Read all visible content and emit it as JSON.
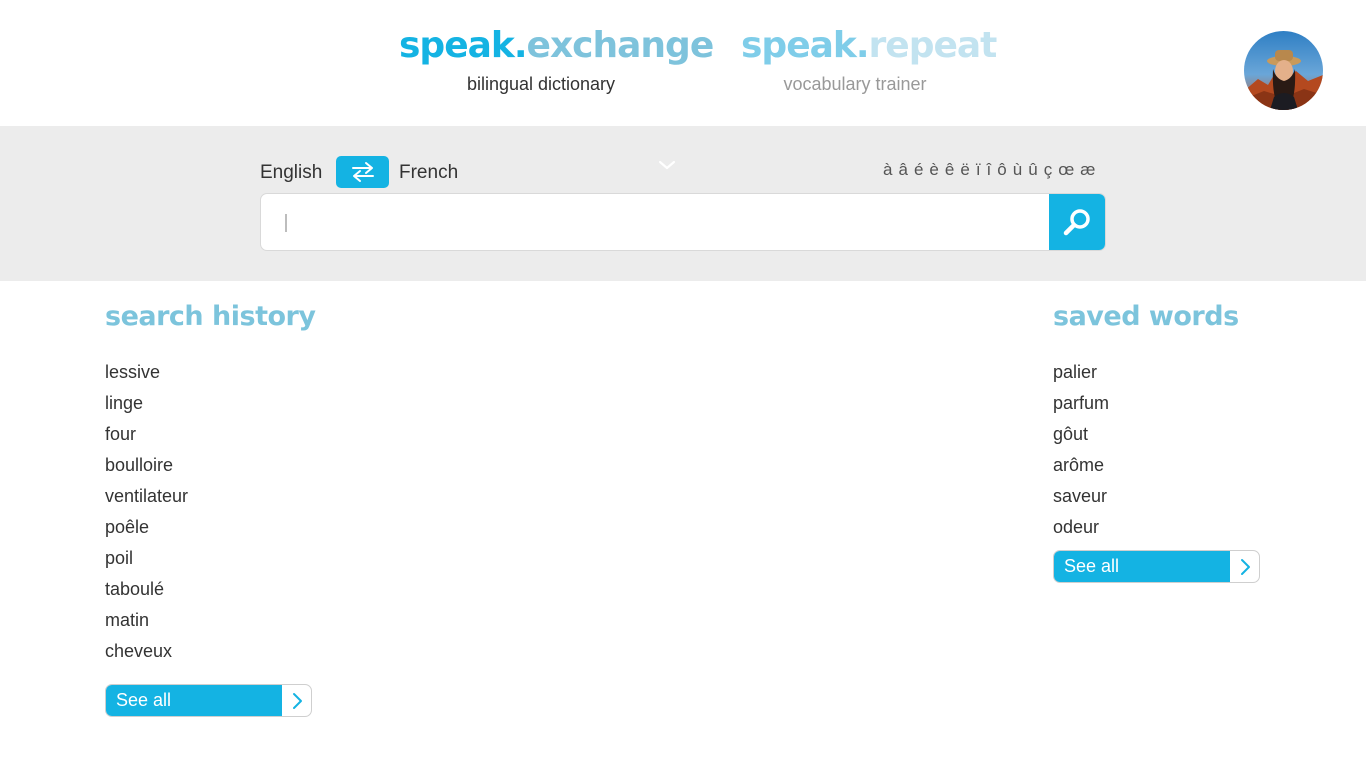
{
  "header": {
    "exchange": {
      "logo_part1": "speak.",
      "logo_part2": "exchange",
      "subtitle": "bilingual dictionary"
    },
    "repeat": {
      "logo_part1": "speak.",
      "logo_part2": "repeat",
      "subtitle": "vocabulary trainer"
    },
    "avatar_icon": "user-avatar-photo"
  },
  "search": {
    "source_language": "English",
    "target_language": "French",
    "swap_icon": "swap-arrows-icon",
    "dropdown_icon": "chevron-down-icon",
    "accents": [
      "à",
      "â",
      "é",
      "è",
      "ê",
      "ë",
      "ï",
      "î",
      "ô",
      "ù",
      "û",
      "ç",
      "œ",
      "æ"
    ],
    "input_value": "",
    "input_placeholder": "",
    "button_icon": "magnifier-icon"
  },
  "history": {
    "title": "search history",
    "items": [
      "lessive",
      "linge",
      "four",
      "boulloire",
      "ventilateur",
      "poêle",
      "poil",
      "taboulé",
      "matin",
      "cheveux"
    ],
    "see_all_label": "See all"
  },
  "saved": {
    "title": "saved words",
    "items": [
      "palier",
      "parfum",
      "gôut",
      "arôme",
      "saveur",
      "odeur"
    ],
    "see_all_label": "See all"
  },
  "colors": {
    "accent": "#14b3e3",
    "title_blue": "#7cc4dc",
    "band_gray": "#ececec"
  }
}
